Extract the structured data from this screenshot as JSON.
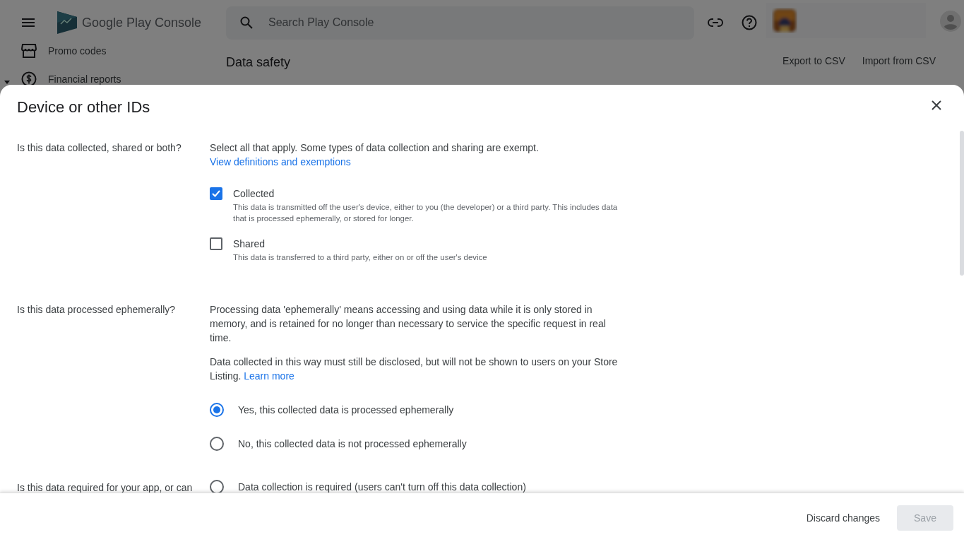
{
  "top_bar": {
    "product_name": "Google Play Console",
    "search": {
      "placeholder": "Search Play Console"
    }
  },
  "nav": [
    {
      "kind": "store",
      "label": "Promo codes"
    },
    {
      "kind": "money",
      "label": "Financial reports"
    }
  ],
  "page": {
    "title": "Data safety",
    "actions": [
      "Export to CSV",
      "Import from CSV"
    ]
  },
  "dialog": {
    "title": "Device or other IDs",
    "sections": [
      {
        "question": "Is this data collected, shared or both?",
        "paragraphs": [
          {
            "text": "Select all that apply. Some types of data collection and sharing are exempt."
          }
        ],
        "link": "View definitions and exemptions",
        "options": [
          {
            "kind": "checkbox",
            "label": "Collected",
            "description": "This data is transmitted off the user's device, either to you (the developer) or a third party. This includes data that is processed ephemerally, or stored for longer.",
            "checked": true
          },
          {
            "kind": "checkbox",
            "label": "Shared",
            "description": "This data is transferred to a third party, either on or off the user's device",
            "checked": false
          }
        ]
      },
      {
        "question": "Is this data processed ephemerally?",
        "paragraphs": [
          {
            "text": "Processing data 'ephemerally' means accessing and using data while it is only stored in memory, and is retained for no longer than necessary to service the specific request in real time."
          },
          {
            "text": "Data collected in this way must still be disclosed, but will not be shown to users on your Store Listing.",
            "link": "Learn more"
          }
        ],
        "options": [
          {
            "kind": "radio",
            "label": "Yes, this collected data is processed ephemerally",
            "selected": true
          },
          {
            "kind": "radio",
            "label": "No, this collected data is not processed ephemerally",
            "selected": false
          }
        ]
      },
      {
        "question": "Is this data required for your app, or can",
        "options": [
          {
            "kind": "radio",
            "label": "Data collection is required (users can't turn off this data collection)",
            "selected": false
          }
        ]
      }
    ]
  },
  "footer": {
    "buttons": [
      {
        "label": "Discard changes",
        "disabled": false
      },
      {
        "label": "Save",
        "disabled": true
      }
    ]
  }
}
